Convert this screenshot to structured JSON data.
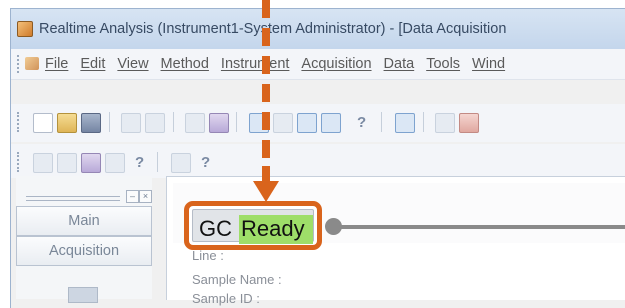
{
  "window": {
    "title": "Realtime Analysis (Instrument1-System Administrator) - [Data Acquisition"
  },
  "menubar": {
    "items": [
      "File",
      "Edit",
      "View",
      "Method",
      "Instrument",
      "Acquisition",
      "Data",
      "Tools",
      "Wind"
    ]
  },
  "toolbar": {
    "help_label": "?",
    "help_label_2": "?",
    "help_label_3": "?"
  },
  "nav": {
    "items": [
      {
        "label": "Main"
      },
      {
        "label": "Acquisition"
      }
    ],
    "close_glyph": "×",
    "minimize_glyph": "–"
  },
  "status": {
    "prefix": "GC",
    "value": "Ready",
    "value_color": "#9ede69",
    "highlight_color": "#d9641c"
  },
  "info": {
    "line_label": "Line :",
    "sample_name_label": "Sample Name :",
    "sample_id_label": "Sample ID :"
  },
  "icons": [
    "app-icon",
    "new-document-icon",
    "open-folder-icon",
    "save-disk-icon",
    "print-icon",
    "print-preview-icon",
    "copy-icon",
    "find-icon",
    "layout-icon",
    "help-icon",
    "arrow-down-icon"
  ]
}
